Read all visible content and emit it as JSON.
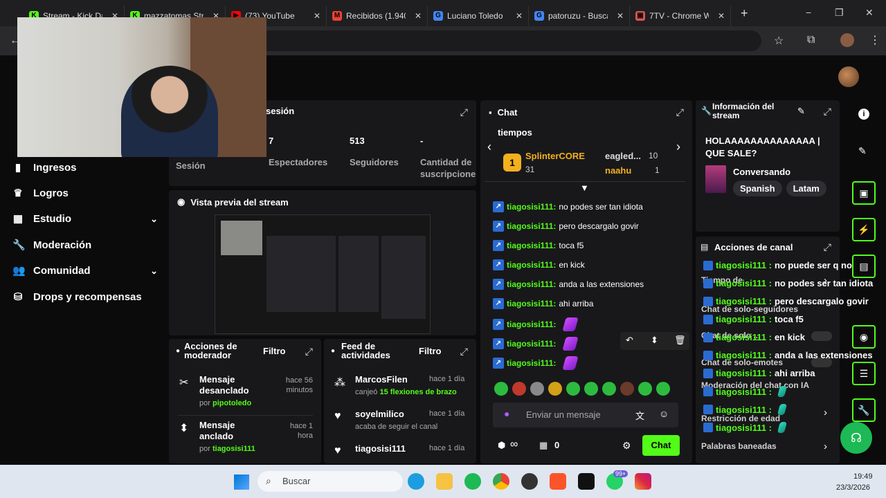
{
  "browser": {
    "tabs": [
      {
        "label": "Stream - Kick Da",
        "color": "#53fc18",
        "glyph": "K"
      },
      {
        "label": "mazzatomas Stre",
        "color": "#53fc18",
        "glyph": "K"
      },
      {
        "label": "(73) YouTube",
        "color": "#ff0000",
        "glyph": "▶"
      },
      {
        "label": "Recibidos (1.940",
        "color": "#ea4335",
        "glyph": "M"
      },
      {
        "label": "Luciano Toledo",
        "color": "#4285f4",
        "glyph": "G"
      },
      {
        "label": "patoruzu - Busca",
        "color": "#4285f4",
        "glyph": "G"
      },
      {
        "label": "7TV - Chrome W",
        "color": "#d9534f",
        "glyph": "▣"
      }
    ],
    "new_tab": "+",
    "controls": {
      "minimize": "−",
      "maximize": "❐",
      "close": "✕"
    }
  },
  "sidebar": {
    "items": [
      {
        "label": "Ingresos",
        "icon": "chart-icon"
      },
      {
        "label": "Logros",
        "icon": "trophy-icon"
      },
      {
        "label": "Estudio",
        "icon": "studio-icon",
        "expandable": true
      },
      {
        "label": "Moderación",
        "icon": "wrench-icon"
      },
      {
        "label": "Comunidad",
        "icon": "community-icon",
        "expandable": true
      },
      {
        "label": "Drops y recompensas",
        "icon": "drops-icon"
      }
    ]
  },
  "session": {
    "title": "sesión",
    "stats": [
      {
        "value": "",
        "label": "Sesión"
      },
      {
        "value": "7",
        "label": "Espectadores"
      },
      {
        "value": "513",
        "label": "Seguidores"
      },
      {
        "value": "-",
        "label": "Cantidad de suscripcione"
      }
    ]
  },
  "preview": {
    "title": "Vista previa del stream"
  },
  "mod_actions": {
    "title": "Acciones de moderador",
    "filter": "Filtro",
    "items": [
      {
        "title": "Mensaje desanclado",
        "time": "hace 56 minutos",
        "by": "por",
        "user": "pipotoledo"
      },
      {
        "title": "Mensaje anclado",
        "time": "hace 1 hora",
        "by": "por",
        "user": "tiagosisi111"
      }
    ]
  },
  "activity": {
    "title": "Feed de actividades",
    "filter": "Filtro",
    "items": [
      {
        "user": "MarcosFilen",
        "time": "hace 1 día",
        "text_pre": "canjeó",
        "highlight": "15 flexiones de brazo"
      },
      {
        "user": "soyelmilico",
        "time": "hace 1 día",
        "text_pre": "acaba de seguir el canal",
        "highlight": ""
      },
      {
        "user": "tiagosisi111",
        "time": "hace 1 día",
        "text_pre": "",
        "highlight": ""
      }
    ]
  },
  "chat": {
    "title": "Chat",
    "leaderboard_title": "tiempos",
    "leaders": [
      {
        "rank": "1",
        "name": "SplinterCORE",
        "score": "31"
      },
      {
        "rank": "",
        "name": "eagled...",
        "score": "10"
      },
      {
        "rank": "",
        "name": "naahu",
        "score": "1"
      }
    ],
    "messages": [
      {
        "user": "tiagosisi111:",
        "text": "no podes ser tan idiota"
      },
      {
        "user": "tiagosisi111:",
        "text": "pero descargalo govir"
      },
      {
        "user": "tiagosisi111:",
        "text": "toca f5"
      },
      {
        "user": "tiagosisi111:",
        "text": "en kick"
      },
      {
        "user": "tiagosisi111:",
        "text": "anda a las extensiones"
      },
      {
        "user": "tiagosisi111:",
        "text": "ahi arriba"
      },
      {
        "user": "tiagosisi111:",
        "text": ""
      },
      {
        "user": "tiagosisi111:",
        "text": ""
      },
      {
        "user": "tiagosisi111:",
        "text": ""
      }
    ],
    "input_placeholder": "Enviar un mensaje",
    "points": "∞",
    "store_count": "0",
    "send_label": "Chat"
  },
  "stream_info": {
    "title": "Información del stream",
    "stream_title": "HOLAAAAAAAAAAAAAA | QUE SALE?",
    "category": "Conversando",
    "tags": [
      "Spanish",
      "Latam"
    ]
  },
  "channel_actions": {
    "title": "Acciones de canal",
    "overlay_messages": [
      {
        "user": "tiagosisi111 :",
        "text": "no puede ser q no"
      },
      {
        "user": "tiagosisi111 :",
        "text": "no podes ser tan idiota"
      },
      {
        "user": "tiagosisi111 :",
        "text": "pero descargalo govir"
      },
      {
        "user": "tiagosisi111 :",
        "text": "toca f5"
      },
      {
        "user": "tiagosisi111 :",
        "text": "en kick"
      },
      {
        "user": "tiagosisi111 :",
        "text": "anda a las extensiones"
      },
      {
        "user": "tiagosisi111 :",
        "text": "ahi arriba"
      },
      {
        "user": "tiagosisi111 :",
        "text": ""
      },
      {
        "user": "tiagosisi111 :",
        "text": ""
      },
      {
        "user": "tiagosisi111 :",
        "text": ""
      }
    ],
    "settings": [
      "Tiempo de",
      "Chat de solo-seguidores",
      "Chat de solo ...",
      "Chat de solo-emotes",
      "Moderación del chat con IA",
      "Restricción de edad",
      "Palabras baneadas"
    ]
  },
  "taskbar": {
    "search": "Buscar",
    "time": "19:49",
    "date": "23/3/2026",
    "badge": "99+"
  }
}
